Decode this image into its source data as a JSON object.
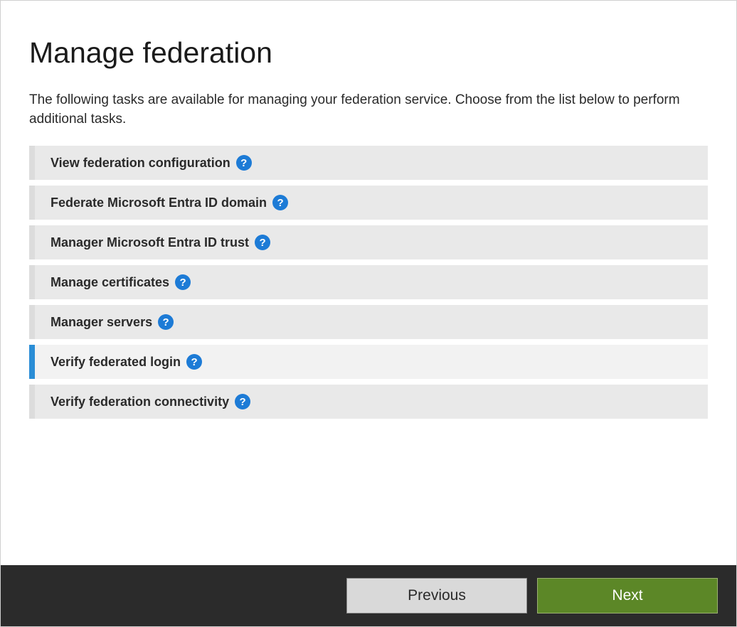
{
  "title": "Manage federation",
  "description": "The following tasks are available for managing your federation service.  Choose from the list below to perform additional tasks.",
  "tasks": [
    {
      "label": "View federation configuration",
      "selected": false
    },
    {
      "label": "Federate Microsoft Entra ID domain",
      "selected": false
    },
    {
      "label": "Manager Microsoft Entra ID trust",
      "selected": false
    },
    {
      "label": "Manage certificates",
      "selected": false
    },
    {
      "label": "Manager servers",
      "selected": false
    },
    {
      "label": "Verify federated login",
      "selected": true
    },
    {
      "label": "Verify federation connectivity",
      "selected": false
    }
  ],
  "footer": {
    "previous": "Previous",
    "next": "Next"
  }
}
